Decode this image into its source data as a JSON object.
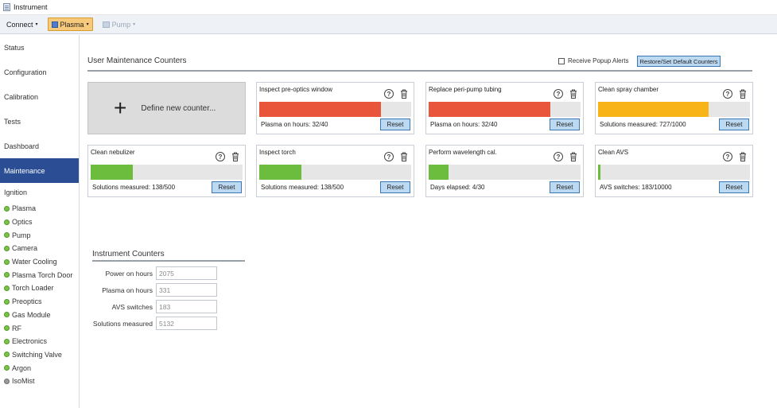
{
  "window": {
    "title": "Instrument"
  },
  "toolbar": {
    "connect_label": "Connect",
    "plasma_label": "Plasma",
    "pump_label": "Pump",
    "caret": "▾"
  },
  "sidebar": {
    "nav": [
      {
        "label": "Status"
      },
      {
        "label": "Configuration"
      },
      {
        "label": "Calibration"
      },
      {
        "label": "Tests"
      },
      {
        "label": "Dashboard"
      },
      {
        "label": "Maintenance",
        "active": true
      }
    ],
    "ignition": {
      "label": "Ignition",
      "items": [
        {
          "label": "Plasma",
          "status": "green"
        },
        {
          "label": "Optics",
          "status": "green"
        },
        {
          "label": "Pump",
          "status": "green"
        },
        {
          "label": "Camera",
          "status": "green"
        },
        {
          "label": "Water Cooling",
          "status": "green"
        },
        {
          "label": "Plasma Torch Door",
          "status": "green"
        },
        {
          "label": "Torch Loader",
          "status": "green"
        },
        {
          "label": "Preoptics",
          "status": "green"
        },
        {
          "label": "Gas Module",
          "status": "green"
        },
        {
          "label": "RF",
          "status": "green"
        },
        {
          "label": "Electronics",
          "status": "green"
        },
        {
          "label": "Switching Valve",
          "status": "green"
        },
        {
          "label": "Argon",
          "status": "green"
        },
        {
          "label": "IsoMist",
          "status": "gray"
        }
      ]
    }
  },
  "maintenance": {
    "title": "User Maintenance Counters",
    "alerts_label": "Receive Popup Alerts",
    "restore_label": "Restore/Set Default Counters",
    "define_label": "Define new counter...",
    "define_icon": "+",
    "help_glyph": "?",
    "reset_label": "Reset",
    "colors": {
      "red": "#e9553b",
      "amber": "#f8b316",
      "green": "#6cbc3e"
    },
    "counters": [
      {
        "title": "Inspect pre-optics window",
        "status": "Plasma on hours: 32/40",
        "fraction": 0.8,
        "color": "#e9553b"
      },
      {
        "title": "Replace peri-pump tubing",
        "status": "Plasma on hours: 32/40",
        "fraction": 0.8,
        "color": "#e9553b"
      },
      {
        "title": "Clean spray chamber",
        "status": "Solutions measured: 727/1000",
        "fraction": 0.727,
        "color": "#f8b316"
      },
      {
        "title": "Clean nebulizer",
        "status": "Solutions measured: 138/500",
        "fraction": 0.276,
        "color": "#6cbc3e"
      },
      {
        "title": "Inspect torch",
        "status": "Solutions measured: 138/500",
        "fraction": 0.276,
        "color": "#6cbc3e"
      },
      {
        "title": "Perform wavelength cal.",
        "status": "Days elapsed: 4/30",
        "fraction": 0.133,
        "color": "#6cbc3e"
      },
      {
        "title": "Clean AVS",
        "status": "AVS switches: 183/10000",
        "fraction": 0.0183,
        "color": "#6cbc3e"
      }
    ]
  },
  "instrument_counters": {
    "title": "Instrument Counters",
    "rows": [
      {
        "label": "Power on hours",
        "value": "2075"
      },
      {
        "label": "Plasma on hours",
        "value": "331"
      },
      {
        "label": "AVS switches",
        "value": "183"
      },
      {
        "label": "Solutions measured",
        "value": "5132"
      }
    ]
  }
}
